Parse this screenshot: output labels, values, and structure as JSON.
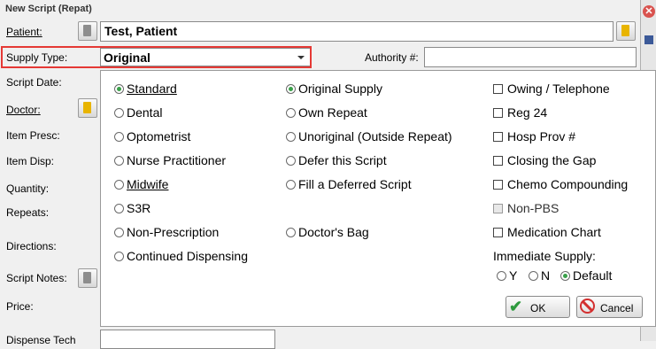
{
  "window": {
    "title": "New Script (Repat)",
    "close_glyph": "✕"
  },
  "labels": {
    "patient": "Patient:",
    "supply_type": "Supply Type:",
    "script_date": "Script Date:",
    "doctor": "Doctor:",
    "item_presc": "Item Presc:",
    "item_disp": "Item Disp:",
    "quantity": "Quantity:",
    "repeats": "Repeats:",
    "directions": "Directions:",
    "script_notes": "Script Notes:",
    "price": "Price:",
    "dispense_tech": "Dispense Tech",
    "authority": "Authority #:"
  },
  "fields": {
    "patient_value": "Test, Patient",
    "supply_type_value": "Original",
    "authority_value": ""
  },
  "dropdown": {
    "col1": {
      "standard": "Standard",
      "dental": "Dental",
      "optometrist": "Optometrist",
      "nurse_practitioner": "Nurse Practitioner",
      "midwife": "Midwife",
      "s3r": "S3R",
      "non_prescription": "Non-Prescription",
      "continued_dispensing": "Continued Dispensing"
    },
    "col2": {
      "original_supply": "Original Supply",
      "own_repeat": "Own Repeat",
      "unoriginal": "Unoriginal (Outside Repeat)",
      "defer_script": "Defer this Script",
      "fill_deferred": "Fill a Deferred Script",
      "doctors_bag": "Doctor's Bag"
    },
    "col3": {
      "owing_telephone": "Owing / Telephone",
      "reg24": "Reg 24",
      "hosp_prov": "Hosp Prov #",
      "closing_gap": "Closing the Gap",
      "chemo": "Chemo Compounding",
      "non_pbs": "Non-PBS",
      "medication_chart": "Medication Chart"
    },
    "immediate_supply": {
      "label": "Immediate Supply:",
      "y": "Y",
      "n": "N",
      "default": "Default",
      "selected": "Default"
    },
    "selected_prescriber_type": "Standard",
    "selected_supply": "Original Supply",
    "ok_label": "OK",
    "cancel_label": "Cancel"
  },
  "colors": {
    "highlight": "#e53935",
    "radio_selected": "#3aa04a"
  }
}
